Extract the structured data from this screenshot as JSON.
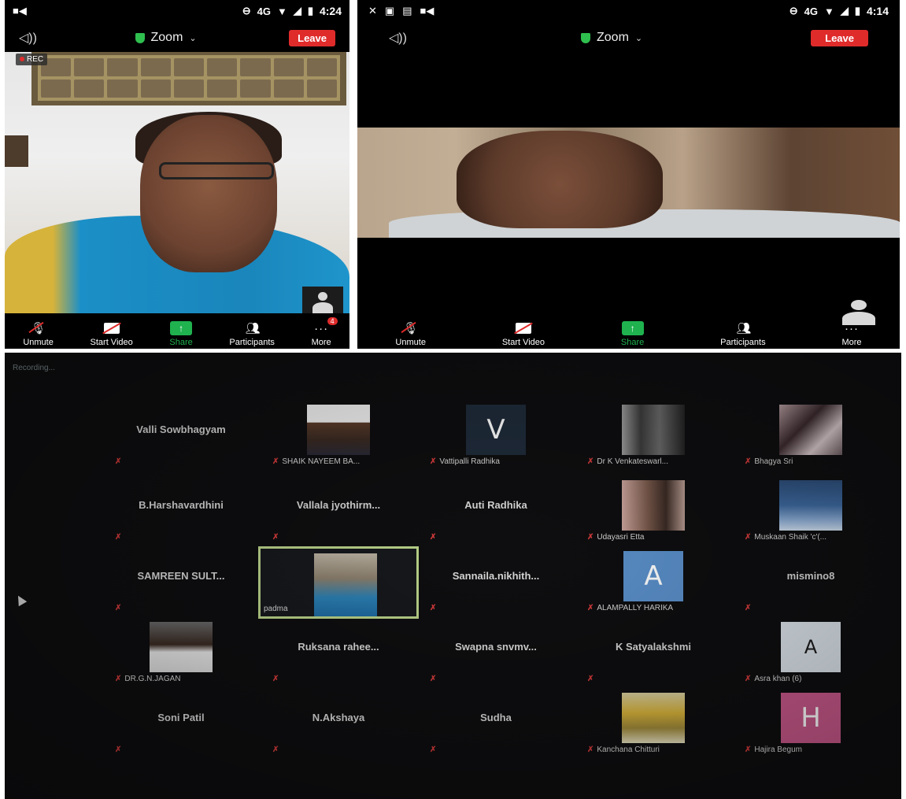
{
  "phones": [
    {
      "status": {
        "time": "4:24",
        "network": "4G"
      },
      "app_title": "Zoom",
      "leave_label": "Leave",
      "rec_label": "REC",
      "toolbar": {
        "unmute": "Unmute",
        "start_video": "Start Video",
        "share": "Share",
        "participants": "Participants",
        "more": "More",
        "more_badge": "4"
      }
    },
    {
      "status": {
        "time": "4:14",
        "network": "4G"
      },
      "app_title": "Zoom",
      "leave_label": "Leave",
      "toolbar": {
        "unmute": "Unmute",
        "start_video": "Start Video",
        "share": "Share",
        "participants": "Participants",
        "more": "More"
      }
    }
  ],
  "gallery": {
    "recording_label": "Recording...",
    "tiles": [
      {
        "name": "Valli Sowbhagyam",
        "label": "",
        "kind": "name"
      },
      {
        "name": "",
        "label": "SHAIK NAYEEM BA...",
        "kind": "photo",
        "photo": "girl"
      },
      {
        "name": "",
        "label": "Vattipalli Radhika",
        "kind": "letter",
        "letter": "V",
        "color": "#1f2b3a"
      },
      {
        "name": "",
        "label": "Dr K Venkateswarl...",
        "kind": "photo",
        "photo": "man-dark"
      },
      {
        "name": "",
        "label": "Bhagya Sri",
        "kind": "photo",
        "photo": "doll"
      },
      {
        "name": "B.Harshavardhini",
        "label": "",
        "kind": "name"
      },
      {
        "name": "Vallala jyothirm...",
        "label": "",
        "kind": "name"
      },
      {
        "name": "Auti Radhika",
        "label": "",
        "kind": "name"
      },
      {
        "name": "",
        "label": "Udayasri Etta",
        "kind": "photo",
        "photo": "woman-phone"
      },
      {
        "name": "",
        "label": "Muskaan Shaik 'c'(...",
        "kind": "photo",
        "photo": "blue-scene"
      },
      {
        "name": "SAMREEN SULT...",
        "label": "",
        "kind": "name"
      },
      {
        "name": "",
        "label": "padma",
        "kind": "video",
        "photo": "padma"
      },
      {
        "name": "Sannaila.nikhith...",
        "label": "",
        "kind": "name"
      },
      {
        "name": "",
        "label": "ALAMPALLY HARIKA",
        "kind": "letter",
        "letter": "A",
        "color": "#5a8fc9"
      },
      {
        "name": "mismino8",
        "label": "",
        "kind": "name"
      },
      {
        "name": "",
        "label": "DR.G.N.JAGAN",
        "kind": "photo",
        "photo": "man-white"
      },
      {
        "name": "Ruksana rahee...",
        "label": "",
        "kind": "name"
      },
      {
        "name": "Swapna snvmv...",
        "label": "",
        "kind": "name"
      },
      {
        "name": "K Satyalakshmi",
        "label": "",
        "kind": "name"
      },
      {
        "name": "",
        "label": "Asra khan (6)",
        "kind": "letter",
        "letter": "A",
        "color": "#dbe3ea",
        "logo": true
      },
      {
        "name": "Soni Patil",
        "label": "",
        "kind": "name"
      },
      {
        "name": "N.Akshaya",
        "label": "",
        "kind": "name"
      },
      {
        "name": "Sudha",
        "label": "",
        "kind": "name"
      },
      {
        "name": "",
        "label": "Kanchana Chitturi",
        "kind": "photo",
        "photo": "tulips"
      },
      {
        "name": "",
        "label": "Hajira Begum",
        "kind": "letter",
        "letter": "H",
        "color": "#c8588a"
      }
    ]
  }
}
